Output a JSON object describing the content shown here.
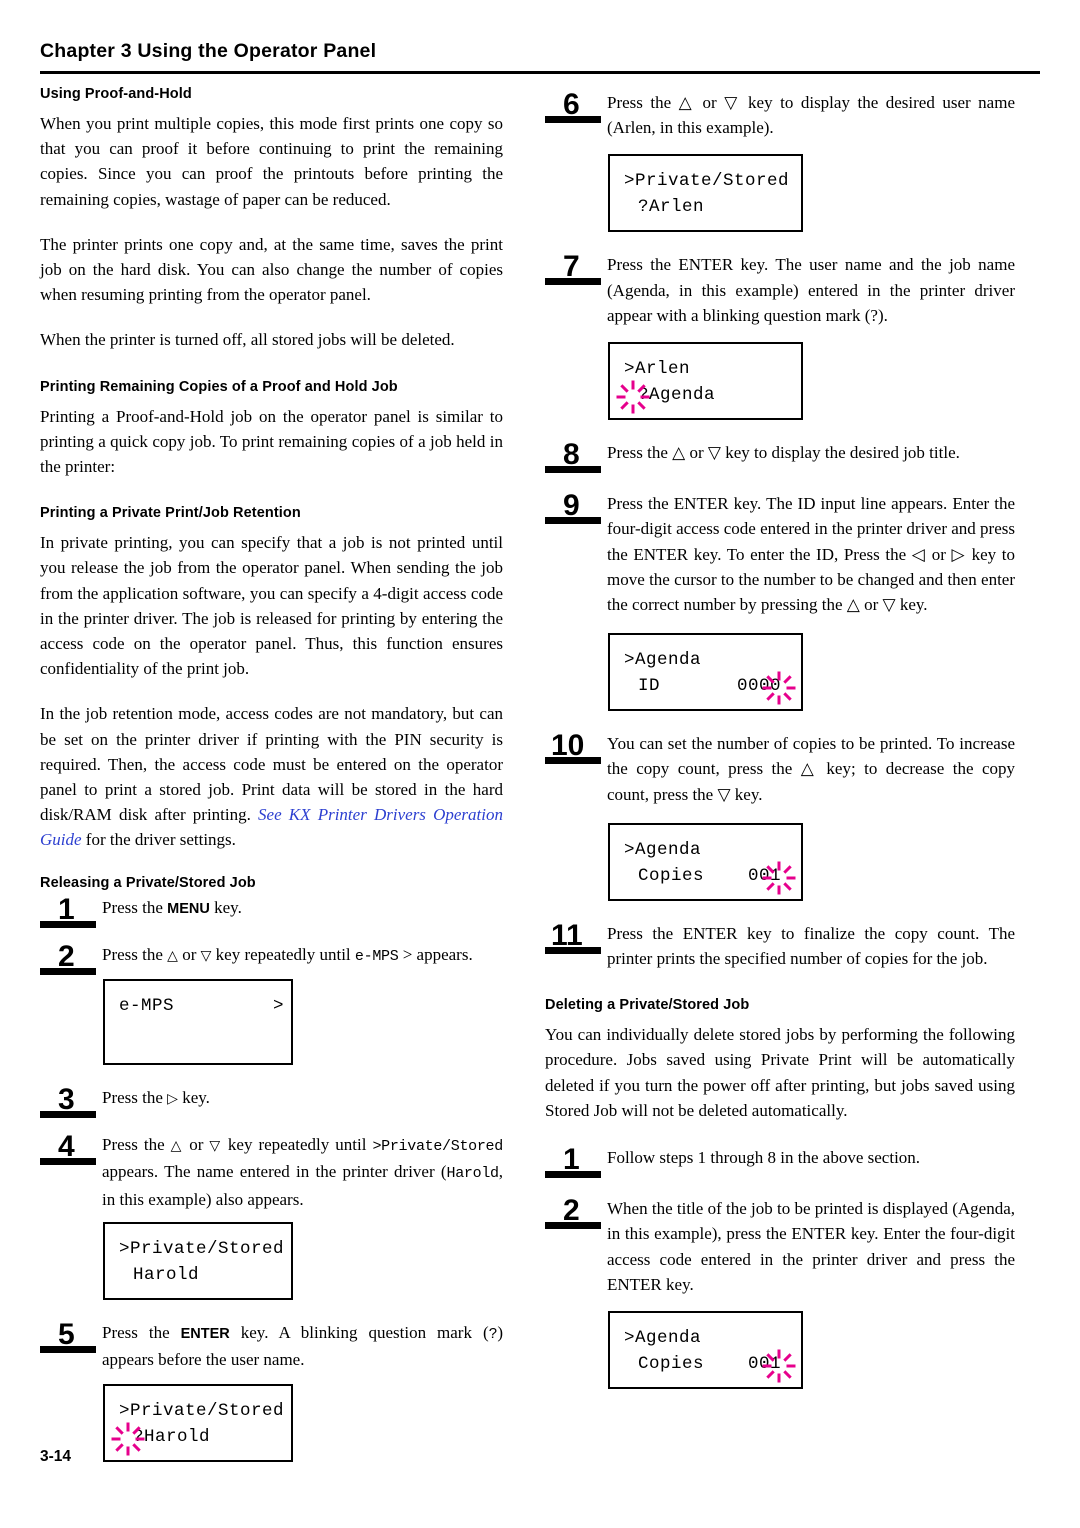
{
  "header": {
    "chapter_label": "Chapter",
    "chapter_number": "3",
    "chapter_title": "Using the Operator Panel"
  },
  "footer": {
    "page_number": "3-14"
  },
  "left_column": {
    "heading_proof": "Using Proof-and-Hold",
    "para_1": "When you print multiple copies, this mode first prints one copy so that you can proof it before continuing to print the remaining copies. Since you can proof the printouts before printing the remaining copies, wastage of paper can be reduced.",
    "para_2": "The printer prints one copy and, at the same time, saves the print job on the hard disk. You can also change the number of copies when resuming printing from the operator panel.",
    "para_3": "When the printer is turned off, all stored jobs will be deleted.",
    "heading_remaining": "Printing Remaining Copies of a Proof and Hold Job",
    "para_4": "Printing a Proof-and-Hold job on the operator panel is similar to printing a quick copy job. To print remaining copies of a job held in the printer:",
    "heading_private": "Printing a Private Print/Job Retention",
    "para_5": "In private printing, you can specify that a job is not printed until you release the job from the operator panel. When sending the job from the application software, you can specify a 4-digit access code in the printer driver. The job is released for printing by entering the access code on the operator panel. Thus, this function ensures confidentiality of the print job.",
    "para_6_a": "In the job retention mode, access codes are not mandatory, but can be set on the printer driver if printing with the PIN security is required. Then, the access code must be entered on the operator panel to print a stored job. Print data will be stored in the hard disk/RAM disk after printing. ",
    "para_6_link": "See KX Printer Drivers Operation Guide",
    "para_6_b": " for the driver settings.",
    "heading_releasing": "Releasing a Private/Stored Job",
    "steps": [
      {
        "number": "1",
        "text_parts": [
          "Press the ",
          "MENU",
          " key."
        ]
      },
      {
        "number": "2",
        "text_parts": [
          "Press the ",
          "△",
          " or ",
          "▽",
          " key repeatedly until ",
          "e-MPS",
          " > appears."
        ]
      },
      {
        "number": "3",
        "text_parts": [
          "Press the ",
          "▷",
          " key."
        ]
      },
      {
        "number": "4",
        "text_parts": [
          "Press the ",
          "△",
          " or ",
          "▽",
          " key repeatedly until ",
          ">Private/Stored",
          " appears. The name entered in the printer driver (",
          "Harold",
          ", in this example) also appears."
        ]
      },
      {
        "number": "5",
        "text_parts": [
          "Press the ",
          "ENTER",
          " key. A blinking question mark (",
          "?",
          ") appears before the user name."
        ]
      }
    ],
    "lcd_emps": {
      "line1": "e-MPS         >",
      "line2": ""
    },
    "lcd_private_harold": {
      "line1": ">Private/Stored",
      "line2": "Harold"
    },
    "lcd_private_qharold": {
      "line1": ">Private/Stored",
      "line2": "?Harold"
    }
  },
  "right_column": {
    "steps": [
      {
        "number": "6",
        "text": "Press the △ or ▽ key to display the desired user name (Arlen, in this example)."
      },
      {
        "number": "7",
        "text": "Press the ENTER key. The user name and the job name (Agenda, in this example) entered in the printer driver appear with a blinking question mark (?)."
      },
      {
        "number": "8",
        "text": "Press the △ or ▽ key to display the desired job title."
      },
      {
        "number": "9",
        "text": "Press the ENTER key. The ID input line appears. Enter the four-digit access code entered in the printer driver and press the ENTER key. To enter the ID, Press the ◁ or ▷ key to move the cursor to the number to be changed and then enter the correct number by pressing the △ or ▽ key."
      },
      {
        "number": "10",
        "text": "You can set the number of copies to be printed. To increase the copy count, press the △ key; to decrease the copy count, press the ▽ key."
      },
      {
        "number": "11",
        "text": "Press the ENTER key to finalize the copy count. The printer prints the specified number of copies for the job."
      }
    ],
    "lcd_private_arlen": {
      "line1": ">Private/Stored",
      "line2": "?Arlen"
    },
    "lcd_arlen_agenda": {
      "line1": ">Arlen",
      "line2": "?Agenda"
    },
    "lcd_agenda_id": {
      "line1": ">Agenda",
      "line2": "ID       0000"
    },
    "lcd_agenda_copies": {
      "line1": ">Agenda",
      "line2": "Copies    001"
    },
    "heading_deleting": "Deleting a Private/Stored Job",
    "para_deleting": "You can individually delete stored jobs by performing the following procedure. Jobs saved using Private Print will be automatically deleted if you turn the power off after printing, but jobs saved using Stored Job will not be deleted automatically.",
    "delete_steps": [
      {
        "number": "1",
        "text": "Follow steps 1 through 8 in the above section."
      },
      {
        "number": "2",
        "text": "When the title of the job to be printed is displayed (Agenda, in this example), press the ENTER key. Enter the four-digit access code entered in the printer driver and press the ENTER key."
      }
    ],
    "lcd_agenda_copies_2": {
      "line1": ">Agenda",
      "line2": "Copies    001"
    }
  }
}
